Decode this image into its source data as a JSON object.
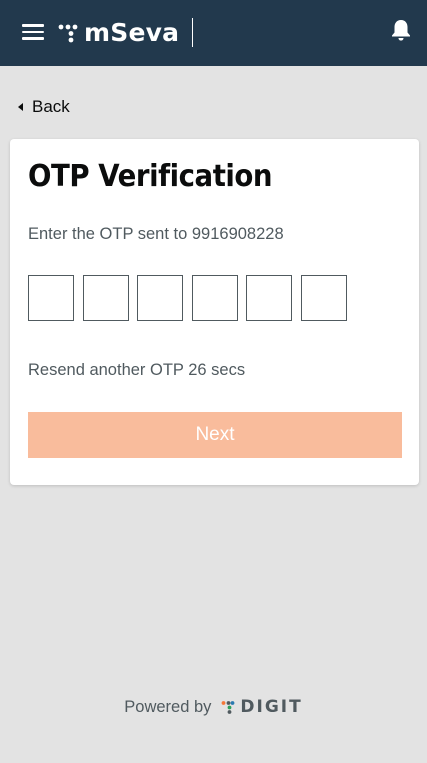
{
  "header": {
    "app_name": "mSeva",
    "menu_icon": "hamburger-menu-icon",
    "notification_icon": "bell-icon",
    "background_color": "#22394d"
  },
  "back": {
    "label": "Back",
    "icon": "chevron-left-icon"
  },
  "otp_card": {
    "title": "OTP Verification",
    "subtitle": "Enter the OTP sent to 9916908228",
    "otp_digits": [
      "",
      "",
      "",
      "",
      "",
      ""
    ],
    "resend_text": "Resend another OTP 26 secs",
    "next_label": "Next",
    "next_button_color": "#f9bc9c"
  },
  "footer": {
    "powered_by": "Powered by",
    "brand": "DIGIT"
  }
}
